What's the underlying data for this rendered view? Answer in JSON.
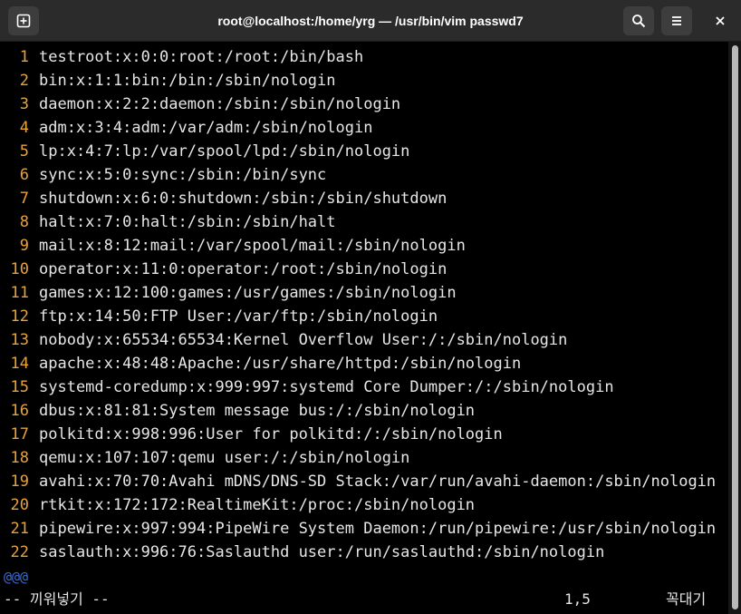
{
  "window": {
    "title": "root@localhost:/home/yrg — /usr/bin/vim passwd7",
    "buttons": {
      "new_tab": "new-tab-icon",
      "search": "search-icon",
      "menu": "hamburger-menu-icon",
      "close": "close-icon"
    }
  },
  "editor": {
    "lines": [
      {
        "num": "1",
        "text": "testroot:x:0:0:root:/root:/bin/bash"
      },
      {
        "num": "2",
        "text": "bin:x:1:1:bin:/bin:/sbin/nologin"
      },
      {
        "num": "3",
        "text": "daemon:x:2:2:daemon:/sbin:/sbin/nologin"
      },
      {
        "num": "4",
        "text": "adm:x:3:4:adm:/var/adm:/sbin/nologin"
      },
      {
        "num": "5",
        "text": "lp:x:4:7:lp:/var/spool/lpd:/sbin/nologin"
      },
      {
        "num": "6",
        "text": "sync:x:5:0:sync:/sbin:/bin/sync"
      },
      {
        "num": "7",
        "text": "shutdown:x:6:0:shutdown:/sbin:/sbin/shutdown"
      },
      {
        "num": "8",
        "text": "halt:x:7:0:halt:/sbin:/sbin/halt"
      },
      {
        "num": "9",
        "text": "mail:x:8:12:mail:/var/spool/mail:/sbin/nologin"
      },
      {
        "num": "10",
        "text": "operator:x:11:0:operator:/root:/sbin/nologin"
      },
      {
        "num": "11",
        "text": "games:x:12:100:games:/usr/games:/sbin/nologin"
      },
      {
        "num": "12",
        "text": "ftp:x:14:50:FTP User:/var/ftp:/sbin/nologin"
      },
      {
        "num": "13",
        "text": "nobody:x:65534:65534:Kernel Overflow User:/:/sbin/nologin"
      },
      {
        "num": "14",
        "text": "apache:x:48:48:Apache:/usr/share/httpd:/sbin/nologin"
      },
      {
        "num": "15",
        "text": "systemd-coredump:x:999:997:systemd Core Dumper:/:/sbin/nologin"
      },
      {
        "num": "16",
        "text": "dbus:x:81:81:System message bus:/:/sbin/nologin"
      },
      {
        "num": "17",
        "text": "polkitd:x:998:996:User for polkitd:/:/sbin/nologin"
      },
      {
        "num": "18",
        "text": "qemu:x:107:107:qemu user:/:/sbin/nologin"
      },
      {
        "num": "19",
        "text": "avahi:x:70:70:Avahi mDNS/DNS-SD Stack:/var/run/avahi-daemon:/sbin/nologin"
      },
      {
        "num": "20",
        "text": "rtkit:x:172:172:RealtimeKit:/proc:/sbin/nologin"
      },
      {
        "num": "21",
        "text": "pipewire:x:997:994:PipeWire System Daemon:/run/pipewire:/usr/sbin/nologin"
      },
      {
        "num": "22",
        "text": "saslauth:x:996:76:Saslauthd user:/run/saslauthd:/sbin/nologin"
      }
    ],
    "filler": "@@@"
  },
  "statusline": {
    "mode": "-- 끼워넣기 --",
    "position": "1,5",
    "mode_right": "꼭대기"
  },
  "colors": {
    "line_number": "#e8a23a",
    "text": "#e6e6e6",
    "filler": "#3d6bd6",
    "titlebar": "#2b2b2b"
  }
}
